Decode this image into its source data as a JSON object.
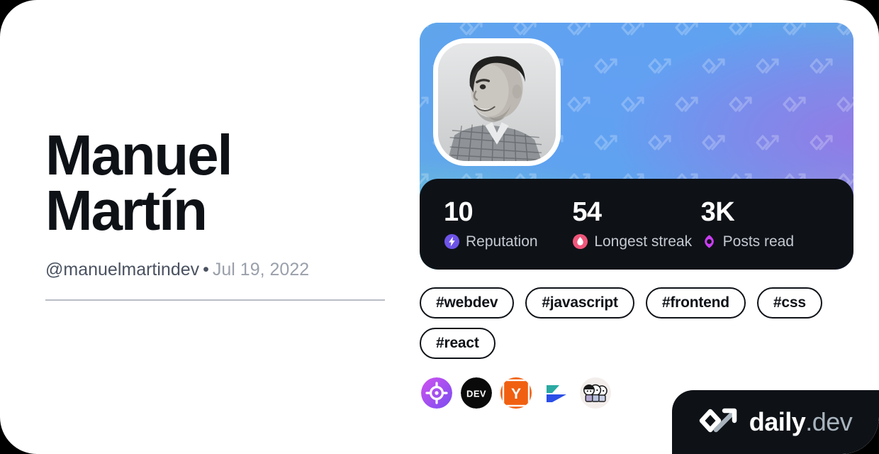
{
  "profile": {
    "display_name": "Manuel\nMartín",
    "handle": "@manuelmartindev",
    "separator": "•",
    "joined_date": "Jul 19, 2022"
  },
  "stats": [
    {
      "value": "10",
      "label": "Reputation",
      "icon": "lightning-bolt-icon",
      "color": "#6e53e8"
    },
    {
      "value": "54",
      "label": "Longest streak",
      "icon": "flame-icon",
      "color": "#f0567a"
    },
    {
      "value": "3K",
      "label": "Posts read",
      "icon": "eye-ring-icon",
      "color": "#cc3df4"
    }
  ],
  "tags": [
    {
      "label": "#webdev"
    },
    {
      "label": "#javascript"
    },
    {
      "label": "#frontend"
    },
    {
      "label": "#css"
    },
    {
      "label": "#react"
    }
  ],
  "sources": [
    {
      "name": "daily-dev-target-source-icon"
    },
    {
      "name": "devto-source-icon",
      "label": "DEV"
    },
    {
      "name": "hackernews-source-icon",
      "label": "Y"
    },
    {
      "name": "arrow-play-source-icon"
    },
    {
      "name": "group-avatars-source-icon"
    }
  ],
  "brand": {
    "name": "daily",
    "tld": ".dev",
    "logo": "daily-dev-logo-icon"
  },
  "colors": {
    "card_background": "#ffffff",
    "page_background": "#000000",
    "text_primary": "#0e1217",
    "text_secondary": "#4a5260",
    "text_muted": "#9aa0ab",
    "panel_dark": "#0e1217",
    "divider": "#b9bdc4"
  }
}
